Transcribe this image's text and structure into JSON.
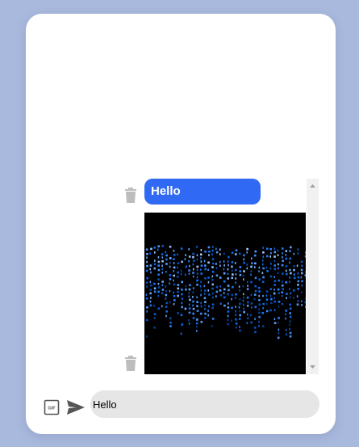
{
  "chat": {
    "messages": [
      {
        "type": "text",
        "text": "Hello"
      },
      {
        "type": "gif",
        "description_icon": "binary-rain-gif"
      }
    ]
  },
  "composer": {
    "input_value": "Hello",
    "gif_button_label": "GIF",
    "send_icon": "send-icon"
  },
  "colors": {
    "background": "#a9b9dd",
    "card": "#ffffff",
    "bubble": "#2f69f4",
    "input": "#e6e6e6",
    "icon_gray": "#bdbdbd",
    "icon_dark": "#555555"
  }
}
